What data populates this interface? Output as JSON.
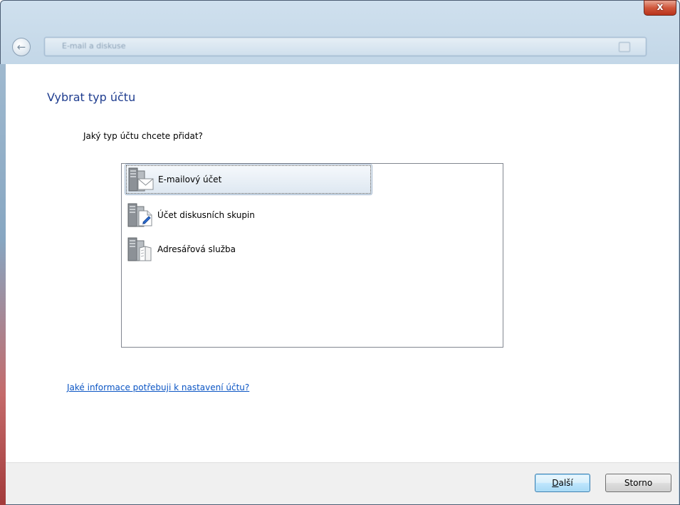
{
  "window": {
    "close_glyph": "x",
    "back_icon": "back-arrow-icon",
    "address_text": "E-mail a diskuse"
  },
  "page": {
    "title": "Vybrat typ účtu",
    "question": "Jaký typ účtu chcete přidat?"
  },
  "account_types": [
    {
      "label": "E-mailový účet",
      "icon": "email-server-icon",
      "selected": true
    },
    {
      "label": "Účet diskusních skupin",
      "icon": "newsgroup-server-icon",
      "selected": false
    },
    {
      "label": "Adresářová služba",
      "icon": "directory-server-icon",
      "selected": false
    }
  ],
  "help_link": "Jaké informace potřebuji k nastavení účtu?",
  "buttons": {
    "next_accel": "D",
    "next_rest": "alší",
    "cancel": "Storno"
  },
  "colors": {
    "title_blue": "#1f3d8f",
    "link_blue": "#0b55c4",
    "selection_border": "#a5b9cf"
  }
}
